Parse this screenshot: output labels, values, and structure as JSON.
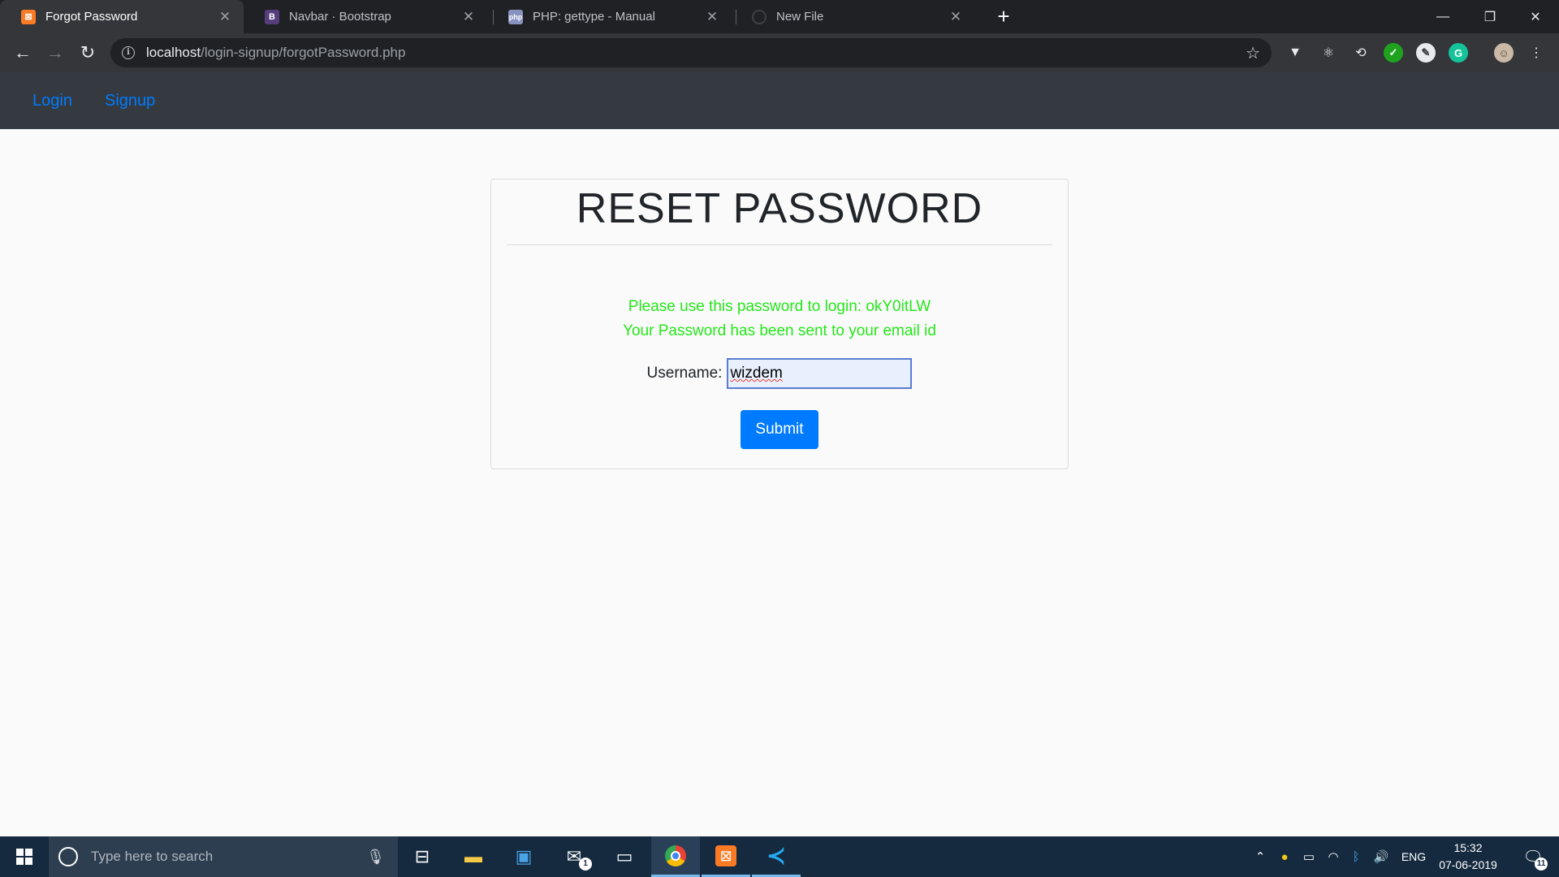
{
  "browser": {
    "tabs": [
      {
        "title": "Forgot Password",
        "favicon_letter": "⊠",
        "favicon_color": "#fb7a24",
        "active": true
      },
      {
        "title": "Navbar · Bootstrap",
        "favicon_letter": "B",
        "favicon_color": "#563d7c",
        "active": false
      },
      {
        "title": "PHP: gettype - Manual",
        "favicon_letter": "php",
        "favicon_color": "#8892bf",
        "active": false
      },
      {
        "title": "New File",
        "favicon_letter": "",
        "favicon_color": "#35363a",
        "active": false
      }
    ],
    "new_tab_glyph": "+",
    "url_host": "localhost",
    "url_path": "/login-signup/forgotPassword.php",
    "extensions": [
      "vue-devtools-icon",
      "react-devtools-icon",
      "sync-icon",
      "check-extension-icon",
      "tag-extension-icon",
      "grammarly-icon"
    ]
  },
  "site": {
    "nav_links": [
      "Login",
      "Signup"
    ],
    "accent_color": "#007bff",
    "navbar_color": "#343a40"
  },
  "form": {
    "title": "RESET PASSWORD",
    "message_password": "Please use this password to login: okY0itLW",
    "message_sent": "Your Password has been sent to your email id",
    "message_color": "#25e71a",
    "username_label": "Username:",
    "username_value": "wizdem",
    "submit_label": "Submit"
  },
  "taskbar": {
    "search_placeholder": "Type here to search",
    "mail_badge": "1",
    "language": "ENG",
    "time": "15:32",
    "date": "07-06-2019",
    "notification_count": "11"
  }
}
